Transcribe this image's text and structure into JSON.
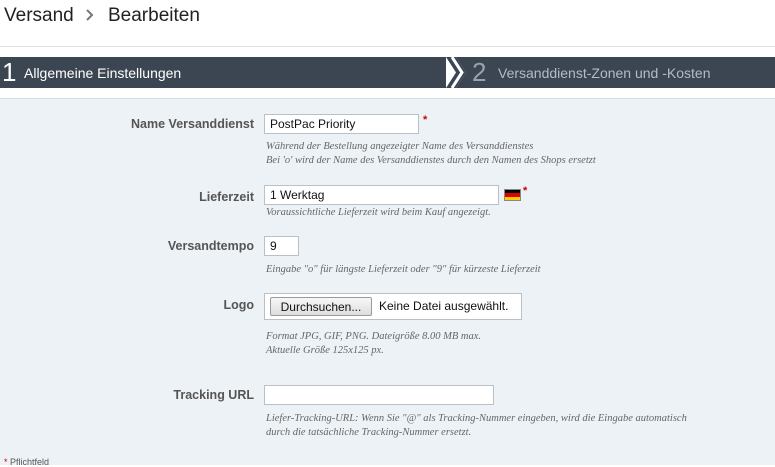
{
  "breadcrumb": {
    "home": "Versand",
    "current": "Bearbeiten"
  },
  "wizard": {
    "steps": [
      {
        "num": "1",
        "label": "Allgemeine Einstellungen"
      },
      {
        "num": "2",
        "label": "Versanddienst-Zonen und -Kosten"
      }
    ]
  },
  "form": {
    "name": {
      "label": "Name Versanddienst",
      "value": "PostPac Priority",
      "hint1": "Während der Bestellung angezeigter Name des Versanddienstes",
      "hint2": "Bei 'o' wird der Name des Versanddienstes durch den Namen des Shops ersetzt"
    },
    "delivery": {
      "label": "Lieferzeit",
      "value": "1 Werktag",
      "hint": "Voraussichtliche Lieferzeit wird beim Kauf angezeigt."
    },
    "speed": {
      "label": "Versandtempo",
      "value": "9",
      "hint": "Eingabe \"o\" für längste Lieferzeit oder \"9\" für kürzeste Lieferzeit"
    },
    "logo": {
      "label": "Logo",
      "button": "Durchsuchen...",
      "status": "Keine Datei ausgewählt.",
      "hint1": "Format JPG, GIF, PNG. Dateigröße 8.00 MB max.",
      "hint2": "Aktuelle Größe 125x125 px."
    },
    "tracking": {
      "label": "Tracking URL",
      "value": "",
      "hint1": "Liefer-Tracking-URL: Wenn Sie \"@\" als Tracking-Nummer eingeben, wird die Eingabe automatisch",
      "hint2": "durch die tatsächliche Tracking-Nummer ersetzt."
    },
    "required_mark": "*"
  },
  "footer": {
    "star": "*",
    "text": "Pflichtfeld"
  },
  "colors": {
    "wizard_bg": "#3c4653",
    "form_bg": "#edf2f6",
    "required": "#cc0000"
  },
  "icons": [
    "chevron-right-icon",
    "german-flag-icon"
  ]
}
